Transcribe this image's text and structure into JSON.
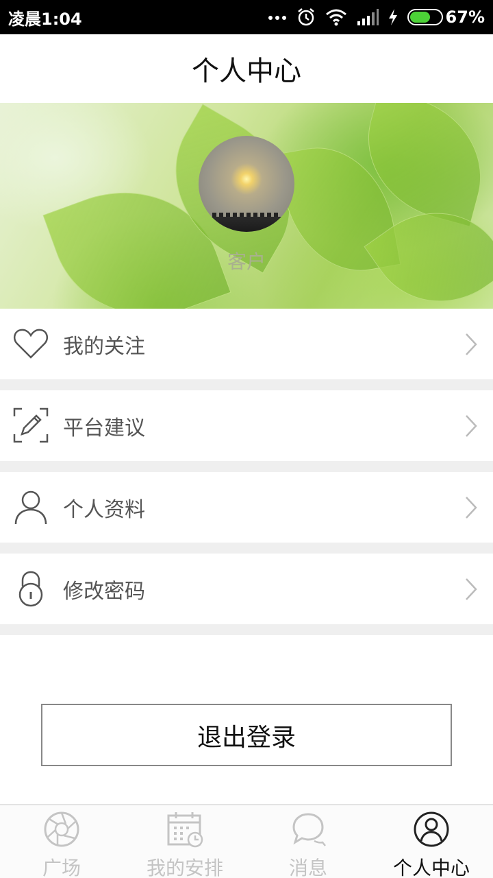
{
  "status_bar": {
    "time": "凌晨1:04",
    "battery_percent": "67%",
    "battery_level": 0.67
  },
  "header": {
    "title": "个人中心"
  },
  "profile": {
    "username": "客户"
  },
  "menu": {
    "items": [
      {
        "label": "我的关注",
        "icon": "heart-icon"
      },
      {
        "label": "平台建议",
        "icon": "edit-icon"
      },
      {
        "label": "个人资料",
        "icon": "user-icon"
      },
      {
        "label": "修改密码",
        "icon": "lock-icon"
      }
    ]
  },
  "logout": {
    "label": "退出登录"
  },
  "bottom_nav": {
    "items": [
      {
        "label": "广场",
        "icon": "aperture-icon",
        "active": false
      },
      {
        "label": "我的安排",
        "icon": "calendar-icon",
        "active": false
      },
      {
        "label": "消息",
        "icon": "chat-icon",
        "active": false
      },
      {
        "label": "个人中心",
        "icon": "user-circle-icon",
        "active": true
      }
    ]
  },
  "colors": {
    "status_bar_bg": "#000000",
    "battery_green": "#4cd137",
    "divider_gray": "#efefef",
    "inactive_nav": "#c4c4c4"
  }
}
